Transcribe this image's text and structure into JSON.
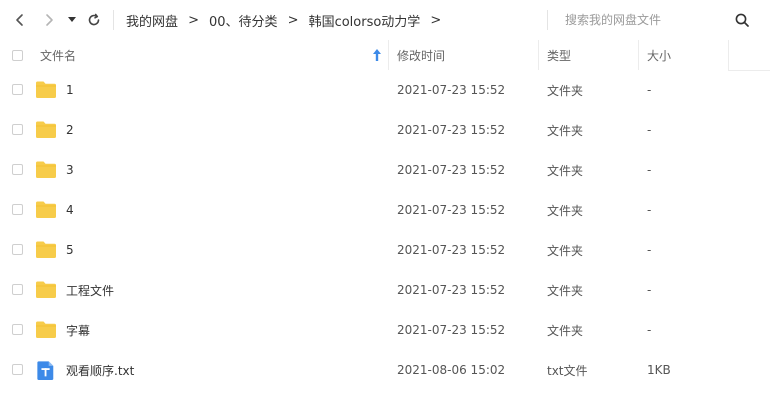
{
  "toolbar": {
    "breadcrumb": [
      {
        "label": "我的网盘"
      },
      {
        "label": "00、待分类"
      },
      {
        "label": "韩国colorso动力学"
      }
    ],
    "crumb_separator": ">",
    "search_placeholder": "搜索我的网盘文件",
    "icons": {
      "back": "chevron-left-icon",
      "forward": "chevron-right-icon",
      "dropdown": "caret-down-icon",
      "refresh": "refresh-icon",
      "search": "search-icon"
    }
  },
  "header": {
    "name_label": "文件名",
    "date_label": "修改时间",
    "type_label": "类型",
    "size_label": "大小",
    "sort_icon": "sort-ascending-arrow-icon",
    "sort_color": "#3d8ae8"
  },
  "files": [
    {
      "name": "1",
      "date": "2021-07-23 15:52",
      "type": "文件夹",
      "size": "-",
      "icon": "folder-icon"
    },
    {
      "name": "2",
      "date": "2021-07-23 15:52",
      "type": "文件夹",
      "size": "-",
      "icon": "folder-icon"
    },
    {
      "name": "3",
      "date": "2021-07-23 15:52",
      "type": "文件夹",
      "size": "-",
      "icon": "folder-icon"
    },
    {
      "name": "4",
      "date": "2021-07-23 15:52",
      "type": "文件夹",
      "size": "-",
      "icon": "folder-icon"
    },
    {
      "name": "5",
      "date": "2021-07-23 15:52",
      "type": "文件夹",
      "size": "-",
      "icon": "folder-icon"
    },
    {
      "name": "工程文件",
      "date": "2021-07-23 15:52",
      "type": "文件夹",
      "size": "-",
      "icon": "folder-icon"
    },
    {
      "name": "字幕",
      "date": "2021-07-23 15:52",
      "type": "文件夹",
      "size": "-",
      "icon": "folder-icon"
    },
    {
      "name": "观看顺序.txt",
      "date": "2021-08-06 15:02",
      "type": "txt文件",
      "size": "1KB",
      "icon": "txt-file-icon"
    }
  ],
  "colors": {
    "folder": "#f7cc4a",
    "txt_file": "#3d8ae8",
    "accent": "#3d8ae8"
  }
}
